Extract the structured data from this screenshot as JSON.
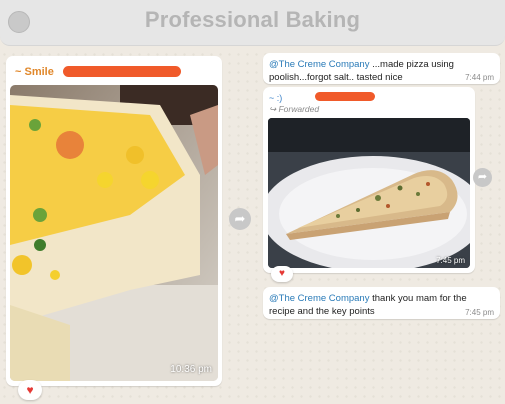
{
  "window": {
    "title": "Professional Baking"
  },
  "left_chat": {
    "message": {
      "sender": "~ Smile",
      "time": "10:36 pm",
      "reaction": "❤️"
    }
  },
  "right_chat": {
    "message1": {
      "mention": "@The Creme Company",
      "text": " ...made pizza using poolish...forgot salt.. tasted nice",
      "time": "7:44 pm"
    },
    "message2": {
      "sender": "~ :)",
      "forwarded_label": "Forwarded",
      "time": "7:45 pm",
      "reaction": "❤️"
    },
    "message3": {
      "mention": "@The Creme Company",
      "text": "  thank you mam for the recipe and the key points",
      "time": "7:45 pm"
    }
  },
  "icons": {
    "forward": "forward-icon",
    "heart": "heart-icon",
    "window_control": "window-dot-icon"
  },
  "colors": {
    "accent_sender": "#e0872a",
    "mention": "#2a7bb8",
    "redaction": "#f05a2a",
    "chat_bg": "#efeae2"
  }
}
